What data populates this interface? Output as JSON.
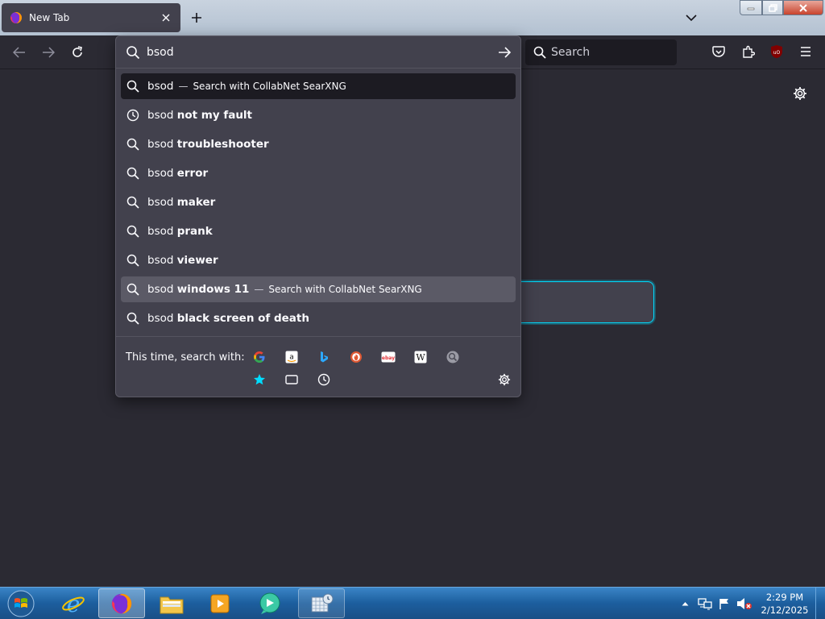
{
  "tab": {
    "title": "New Tab"
  },
  "toolbar": {
    "search_placeholder": "Search"
  },
  "urlbar": {
    "value": "bsod",
    "results": [
      {
        "prefix": "bsod",
        "bold": "",
        "icon": "search-icon",
        "sep": "—",
        "action": "Search with CollabNet SearXNG",
        "state": "selected"
      },
      {
        "prefix": "bsod",
        "bold": "not my fault",
        "icon": "history-clock-icon",
        "sep": "",
        "action": "",
        "state": ""
      },
      {
        "prefix": "bsod",
        "bold": "troubleshooter",
        "icon": "search-icon",
        "sep": "",
        "action": "",
        "state": ""
      },
      {
        "prefix": "bsod",
        "bold": "error",
        "icon": "search-icon",
        "sep": "",
        "action": "",
        "state": ""
      },
      {
        "prefix": "bsod",
        "bold": "maker",
        "icon": "search-icon",
        "sep": "",
        "action": "",
        "state": ""
      },
      {
        "prefix": "bsod",
        "bold": "prank",
        "icon": "search-icon",
        "sep": "",
        "action": "",
        "state": ""
      },
      {
        "prefix": "bsod",
        "bold": "viewer",
        "icon": "search-icon",
        "sep": "",
        "action": "",
        "state": ""
      },
      {
        "prefix": "bsod",
        "bold": "windows 11",
        "icon": "search-icon",
        "sep": "—",
        "action": "Search with CollabNet SearXNG",
        "state": "hover"
      },
      {
        "prefix": "bsod",
        "bold": "black screen of death",
        "icon": "search-icon",
        "sep": "",
        "action": "",
        "state": ""
      }
    ],
    "oneoff_label": "This time, search with:",
    "engines": [
      "google",
      "amazon",
      "bing",
      "duckduckgo",
      "ebay",
      "wikipedia",
      "searxng",
      "bookmarks",
      "tabs",
      "history"
    ]
  },
  "engine_letters": {
    "amazon": "a",
    "ebay": "ebay",
    "wikipedia": "W"
  },
  "clock": {
    "time": "2:29 PM",
    "date": "2/12/2025"
  },
  "colors": {
    "accent": "#00ddff",
    "popup_bg": "#42414d",
    "page_bg": "#2b2a33",
    "ublock": "#800000"
  }
}
